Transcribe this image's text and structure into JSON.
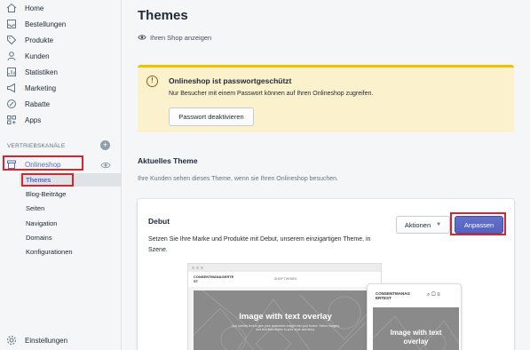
{
  "sidebar": {
    "items": [
      {
        "label": "Home",
        "icon": "home-icon"
      },
      {
        "label": "Bestellungen",
        "icon": "orders-icon"
      },
      {
        "label": "Produkte",
        "icon": "tag-icon"
      },
      {
        "label": "Kunden",
        "icon": "customer-icon"
      },
      {
        "label": "Statistiken",
        "icon": "analytics-icon"
      },
      {
        "label": "Marketing",
        "icon": "marketing-icon"
      },
      {
        "label": "Rabatte",
        "icon": "discount-icon"
      },
      {
        "label": "Apps",
        "icon": "apps-icon"
      }
    ],
    "channels_label": "VERTRIEBSKANÄLE",
    "online_store": "Onlineshop",
    "sub_items": [
      "Themes",
      "Blog-Beiträge",
      "Seiten",
      "Navigation",
      "Domains",
      "Konfigurationen"
    ],
    "settings": "Einstellungen"
  },
  "main": {
    "title": "Themes",
    "view_link": "Ihren Shop anzeigen",
    "banner": {
      "title": "Onlineshop ist passwortgeschützt",
      "text": "Nur Besucher mit einem Passwort können auf Ihren Onlineshop zugreifen.",
      "button": "Passwort deaktivieren"
    },
    "current_theme": {
      "heading": "Aktuelles Theme",
      "description": "Ihre Kunden sehen dieses Theme, wenn sie Ihren Onlineshop besuchen."
    },
    "card": {
      "name": "Debut",
      "description": "Setzen Sie Ihre Marke und Produkte mit Debut, unserem einzigartigen Theme, in Szene.",
      "actions_label": "Aktionen",
      "customize_label": "Anpassen"
    },
    "preview": {
      "desktop_brand": "CONSENTMANAGERTE ST",
      "desktop_nav": "SHOP   THEMES",
      "hero_title": "Image with text overlay",
      "hero_sub": "Use overlay text to give your customers insight into your brand. Select imagery and text that relates to your style and story.",
      "mobile_brand": "CONSENTMANAG ERTEST",
      "mobile_hero_title": "Image with text overlay"
    }
  },
  "colors": {
    "accent": "#5c6ac4",
    "highlight_box": "#d9232d",
    "banner_bg": "#fcf1cd"
  }
}
